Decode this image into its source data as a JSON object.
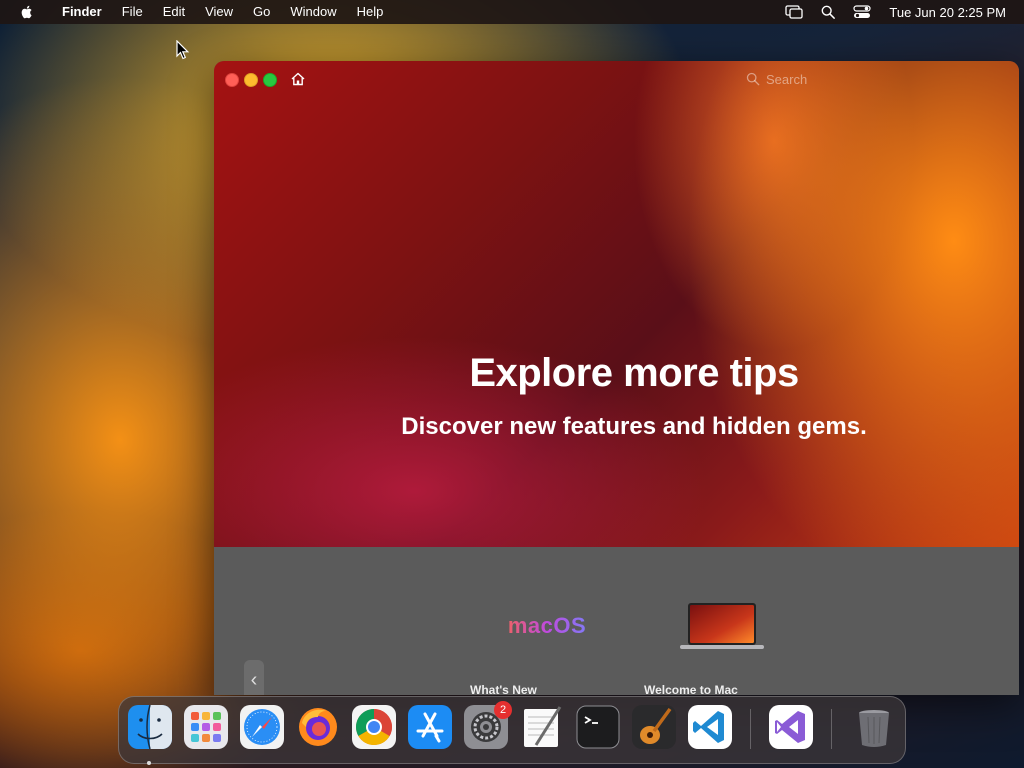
{
  "menubar": {
    "app_name": "Finder",
    "items": [
      "File",
      "Edit",
      "View",
      "Go",
      "Window",
      "Help"
    ],
    "clock": "Tue Jun 20  2:25 PM"
  },
  "window": {
    "search_placeholder": "Search",
    "headline": "Explore more tips",
    "subline": "Discover new features and hidden gems.",
    "prev_arrow": "‹",
    "cards": [
      {
        "logo_text": "macOS",
        "title": "What's New"
      },
      {
        "title": "Welcome to Mac"
      }
    ]
  },
  "dock": {
    "apps": [
      {
        "name": "Finder",
        "icon": "finder-icon",
        "running": true
      },
      {
        "name": "Launchpad",
        "icon": "launchpad-icon"
      },
      {
        "name": "Safari",
        "icon": "safari-icon"
      },
      {
        "name": "Firefox",
        "icon": "firefox-icon"
      },
      {
        "name": "Google Chrome",
        "icon": "chrome-icon"
      },
      {
        "name": "App Store",
        "icon": "app-store-icon"
      },
      {
        "name": "System Settings",
        "icon": "system-settings-icon",
        "badge": "2"
      },
      {
        "name": "TextEdit",
        "icon": "textedit-icon"
      },
      {
        "name": "Terminal",
        "icon": "terminal-icon"
      },
      {
        "name": "GarageBand",
        "icon": "garageband-icon"
      },
      {
        "name": "Visual Studio Code",
        "icon": "vscode-icon"
      },
      {
        "name": "Visual Studio",
        "icon": "visual-studio-icon"
      },
      {
        "name": "Trash",
        "icon": "trash-icon"
      }
    ]
  },
  "colors": {
    "accent_close": "#ff5f57",
    "accent_minimize": "#febc2e",
    "accent_zoom": "#28c840",
    "badge": "#e52f2f"
  }
}
